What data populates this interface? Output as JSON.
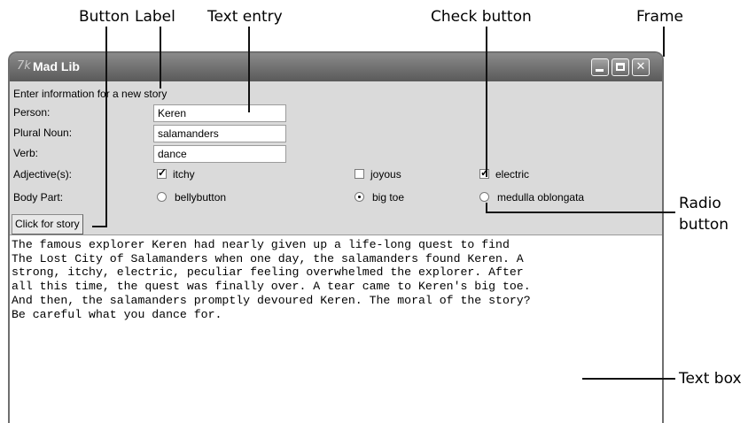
{
  "callouts": {
    "button": "Button",
    "label": "Label",
    "text_entry": "Text entry",
    "check_button": "Check button",
    "frame": "Frame",
    "radio_button_line1": "Radio",
    "radio_button_line2": "button",
    "text_box": "Text box"
  },
  "window": {
    "title_icon": "7k",
    "title": "Mad Lib",
    "controls": {
      "minimize": "minimize",
      "maximize": "maximize",
      "close": "✕"
    }
  },
  "form": {
    "header": "Enter information for a new story",
    "person": {
      "label": "Person:",
      "value": "Keren"
    },
    "plural_noun": {
      "label": "Plural Noun:",
      "value": "salamanders"
    },
    "verb": {
      "label": "Verb:",
      "value": "dance"
    },
    "adjectives": {
      "label": "Adjective(s):",
      "options": [
        {
          "text": "itchy",
          "checked": true
        },
        {
          "text": "joyous",
          "checked": false
        },
        {
          "text": "electric",
          "checked": true
        }
      ]
    },
    "body_part": {
      "label": "Body Part:",
      "options": [
        {
          "text": "bellybutton",
          "selected": false
        },
        {
          "text": "big toe",
          "selected": true
        },
        {
          "text": "medulla oblongata",
          "selected": false
        }
      ]
    },
    "story_button": "Click for story"
  },
  "story": {
    "lines": [
      "The famous explorer Keren had nearly given up a life-long quest to find",
      "The Lost City of Salamanders when one day, the salamanders found Keren. A",
      "strong, itchy, electric, peculiar feeling overwhelmed the explorer. After",
      "all this time, the quest was finally over. A tear came to Keren's big toe.",
      "And then, the salamanders promptly devoured Keren. The moral of the story?",
      "Be careful what you dance for."
    ]
  }
}
